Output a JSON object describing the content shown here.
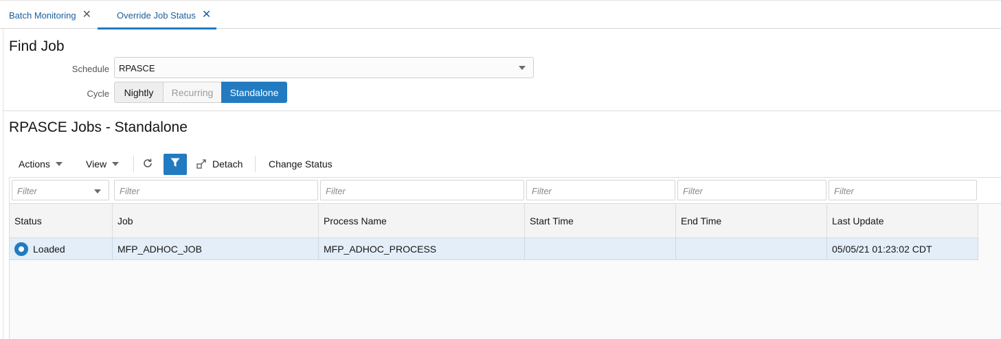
{
  "tabs": [
    {
      "label": "Batch Monitoring",
      "close": "✕"
    },
    {
      "label": "Override Job Status",
      "close": "✕"
    }
  ],
  "find_job": {
    "title": "Find Job",
    "schedule_label": "Schedule",
    "schedule_value": "RPASCE",
    "cycle_label": "Cycle",
    "cycle_options": [
      {
        "label": "Nightly",
        "state": "normal"
      },
      {
        "label": "Recurring",
        "state": "disabled"
      },
      {
        "label": "Standalone",
        "state": "selected"
      }
    ]
  },
  "jobs": {
    "title": "RPASCE Jobs - Standalone",
    "toolbar": {
      "actions": "Actions",
      "view": "View",
      "detach": "Detach",
      "change_status": "Change Status",
      "icons": [
        "refresh-icon",
        "filter-icon",
        "detach-icon"
      ]
    },
    "filter_placeholder": "Filter",
    "columns": [
      "Status",
      "Job",
      "Process Name",
      "Start Time",
      "End Time",
      "Last Update"
    ],
    "rows": [
      {
        "status": "Loaded",
        "job": "MFP_ADHOC_JOB",
        "process": "MFP_ADHOC_PROCESS",
        "start": "",
        "end": "",
        "last_update": "05/05/21 01:23:02 CDT"
      }
    ]
  },
  "colors": {
    "accent": "#227bc1",
    "link": "#1a5e9a",
    "row_selected": "#e3eef9"
  }
}
